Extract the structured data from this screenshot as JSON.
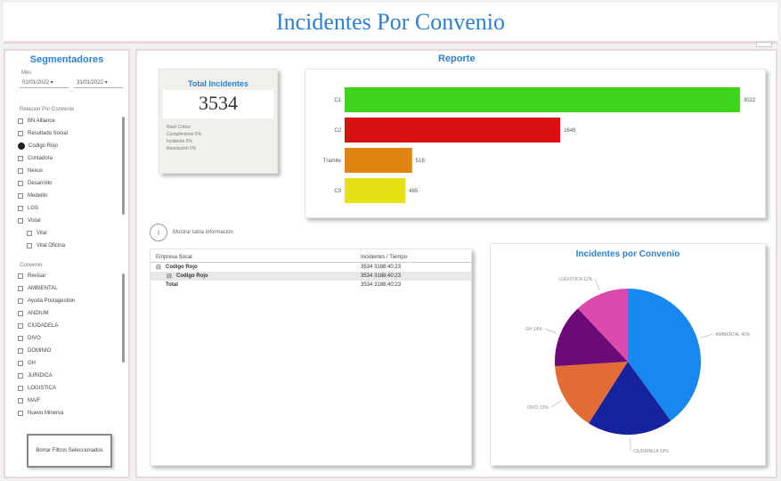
{
  "header": {
    "title": "Incidentes Por Convenio"
  },
  "sidebar": {
    "title": "Segmentadores",
    "date_label": "Mes",
    "date_from": "01/01/2022 ▾",
    "date_to": "31/01/2022 ▾",
    "list1_label": "Relacion Por Convenio",
    "list1_items": [
      {
        "label": "BN Alliance",
        "type": "cb"
      },
      {
        "label": "Resultado Social",
        "type": "cb"
      },
      {
        "label": "Codigo Rojo",
        "type": "radio"
      },
      {
        "label": "Contadora",
        "type": "cb"
      },
      {
        "label": "Nexus",
        "type": "cb"
      },
      {
        "label": "Desarrollo",
        "type": "cb"
      },
      {
        "label": "Medellin",
        "type": "cb"
      },
      {
        "label": "LGS",
        "type": "cb"
      },
      {
        "label": "Vistal",
        "type": "cb"
      },
      {
        "label": "Vital",
        "type": "cb"
      },
      {
        "label": "Vital Oficina",
        "type": "cb"
      }
    ],
    "list2_label": "Convenio",
    "list2_items": [
      "Revisar",
      "AMBIENTAL",
      "Ayuda Postagestion",
      "ANDIUM",
      "CIUDADELA",
      "DIVO",
      "DOMINIO",
      "GH",
      "JURIDICA",
      "LOGISTICA",
      "MAIF",
      "Nuevo Minerva"
    ],
    "reset_button": "Borrar Filtros Seleccionados"
  },
  "main": {
    "report_title": "Reporte",
    "total_card": {
      "title": "Total Incidentes",
      "value": "3534",
      "notes": [
        "Nivel Crítico",
        "Cumplimiento 5%",
        "Incidente 5%",
        "Resolución 5%"
      ]
    },
    "info_text": "Mostrar tabla informacion",
    "table": {
      "col1": "Empresa Socal",
      "col2": "Incidentes / Tiempo",
      "rows": [
        {
          "expand": "⊟",
          "name": "Codigo Rojo",
          "value": "3534 3188:40:23",
          "indent": false,
          "bold": true,
          "selected": false
        },
        {
          "expand": "⊟",
          "name": "Codigo Rojo",
          "value": "3534 3188:40:23",
          "indent": true,
          "bold": true,
          "selected": true
        },
        {
          "expand": "",
          "name": "Total",
          "value": "3534 3188:40:23",
          "indent": false,
          "bold": true,
          "selected": false
        }
      ]
    },
    "pie_title": "Incidentes por Convenio"
  },
  "chart_data": [
    {
      "type": "bar",
      "orientation": "horizontal",
      "categories": [
        "C1",
        "C2",
        "Tramite",
        "C3"
      ],
      "values": [
        3022,
        1648,
        516,
        465
      ],
      "data_labels": [
        "3022",
        "1648",
        "516",
        "465"
      ],
      "colors": [
        "#3fd41c",
        "#d91111",
        "#e08512",
        "#e6e116"
      ],
      "xlim": [
        0,
        3050
      ],
      "grid": false
    },
    {
      "type": "pie",
      "title": "Incidentes por Convenio",
      "labels": [
        "AMBIENTAL",
        "CIUDADELA",
        "DIVO",
        "GH",
        "LOGISTICA"
      ],
      "values": [
        40,
        19,
        15,
        14,
        12
      ],
      "colors": [
        "#1788ef",
        "#17239e",
        "#e16c35",
        "#6c0b77",
        "#dd4aae"
      ]
    }
  ]
}
